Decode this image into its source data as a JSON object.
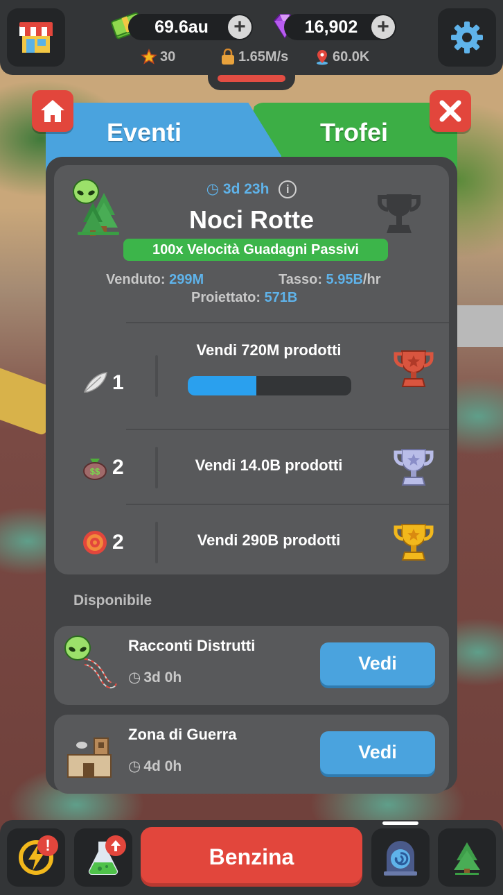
{
  "topbar": {
    "cash": "69.6au",
    "gems": "16,902",
    "stars": "30",
    "income_rate": "1.65M/s",
    "distance": "60.0K",
    "plus_label": "+"
  },
  "tabs": [
    {
      "label": "Eventi"
    },
    {
      "label": "Trofei"
    }
  ],
  "event": {
    "timer": "3d 23h",
    "info": "i",
    "title": "Noci Rotte",
    "boost": "100x Velocità Guadagni Passivi",
    "sold_label": "Venduto:",
    "sold_value": "299M",
    "rate_label": "Tasso:",
    "rate_value": "5.95B",
    "rate_unit": "/hr",
    "projected_label": "Proiettato:",
    "projected_value": "571B",
    "tiers": [
      {
        "reward_icon": "feather-icon",
        "qty": "1",
        "goal": "Vendi 720M prodotti",
        "trophy": "bronze",
        "progress": 0.42
      },
      {
        "reward_icon": "money-bag-icon",
        "qty": "2",
        "goal": "Vendi 14.0B prodotti",
        "trophy": "silver"
      },
      {
        "reward_icon": "target-icon",
        "qty": "2",
        "goal": "Vendi 290B prodotti",
        "trophy": "gold"
      }
    ]
  },
  "available": {
    "label": "Disponibile",
    "events": [
      {
        "title": "Racconti Distrutti",
        "time": "3d 0h",
        "button": "Vedi"
      },
      {
        "title": "Zona di Guerra",
        "time": "4d 0h",
        "button": "Vedi"
      }
    ]
  },
  "bottombar": {
    "main_button": "Benzina",
    "alert": "!"
  },
  "colors": {
    "accent_blue": "#4aa3de",
    "accent_green": "#3cae45",
    "accent_red": "#e2463c",
    "highlight_blue": "#5fb3ea",
    "bronze": "#d9553f",
    "silver": "#b9bde8",
    "gold": "#f2b81c"
  }
}
